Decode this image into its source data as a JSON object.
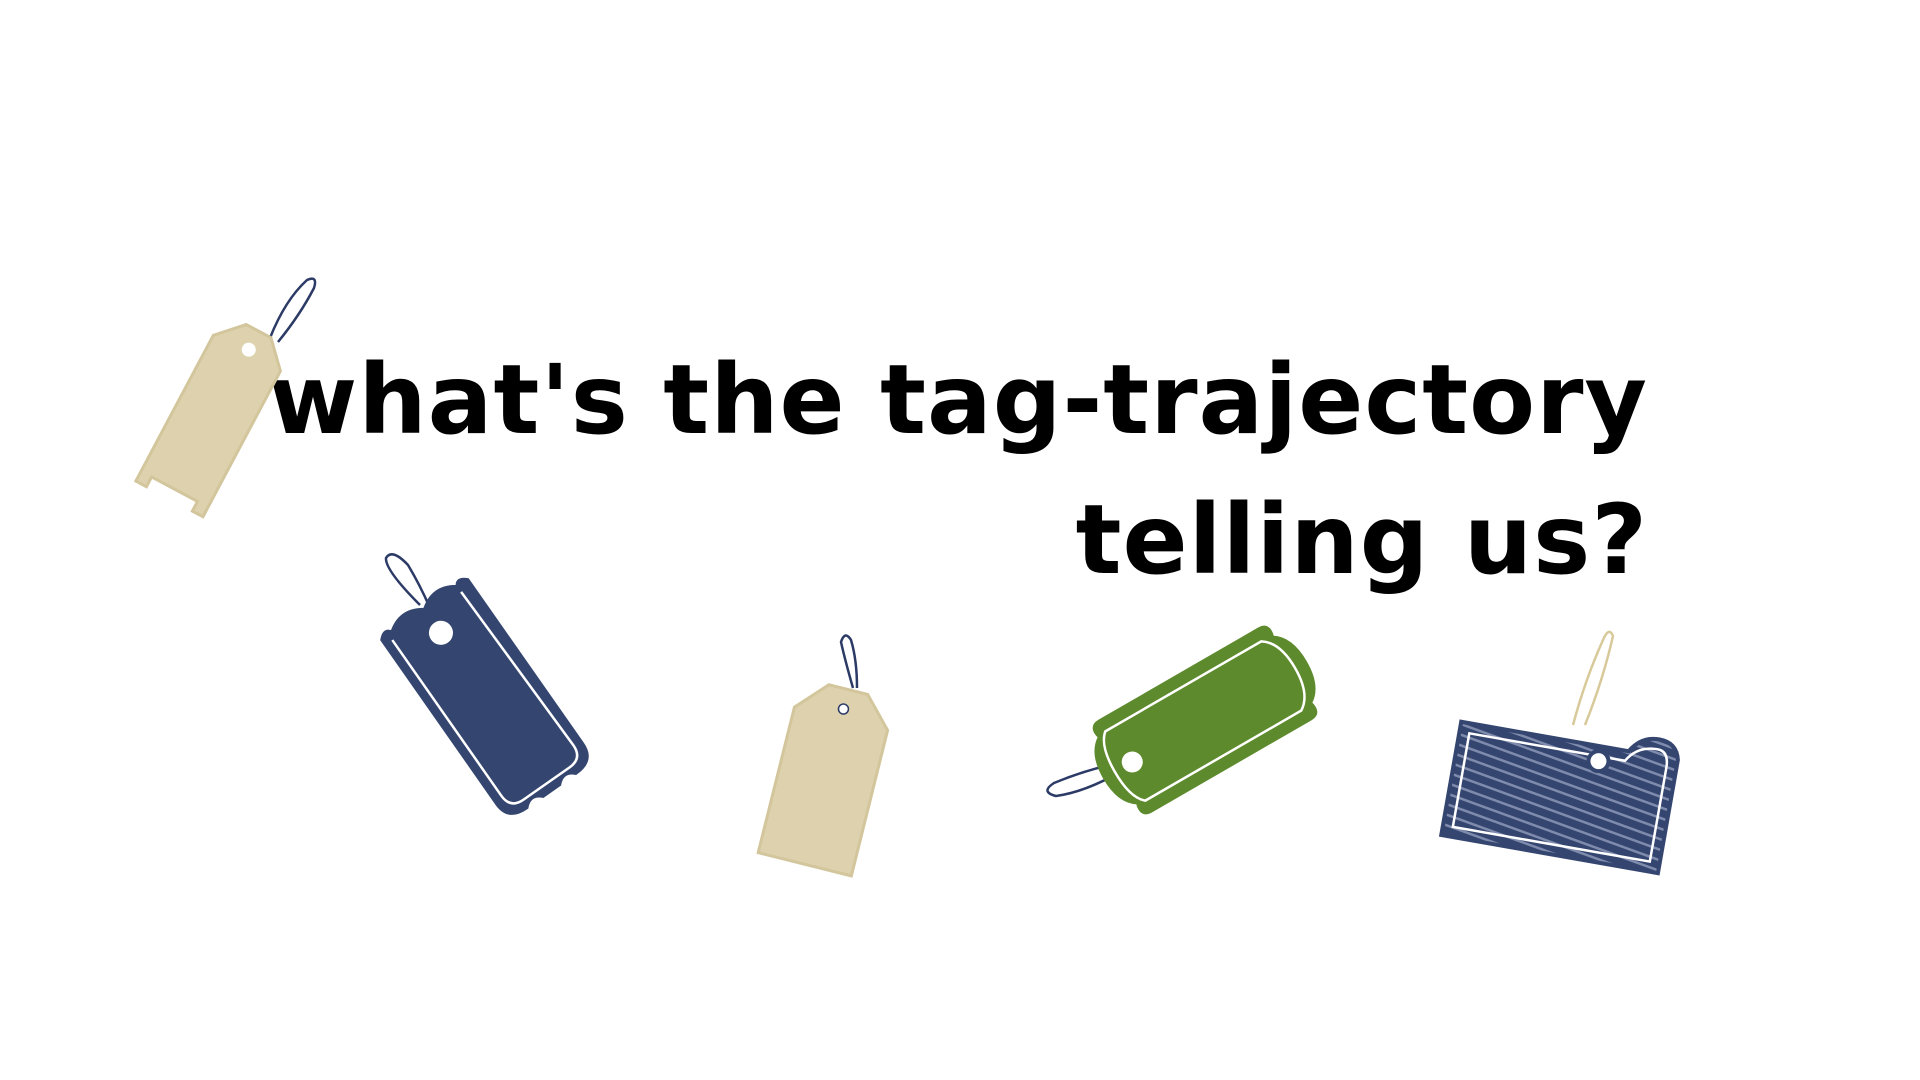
{
  "slide": {
    "headline": {
      "line1": "what's the tag-trajectory",
      "line2": "telling us?"
    }
  },
  "colors": {
    "background": "#ffffff",
    "text": "#000000",
    "tag_beige": "#ddd2ad",
    "tag_navy": "#34456f",
    "tag_green": "#5d8a2c",
    "string_navy": "#2c3a66",
    "string_beige": "#d8c99a"
  },
  "tags": [
    {
      "name": "beige-ticket-tag-icon",
      "color": "tag_beige"
    },
    {
      "name": "navy-scalloped-tag-icon",
      "color": "tag_navy"
    },
    {
      "name": "beige-classic-tag-icon",
      "color": "tag_beige"
    },
    {
      "name": "green-ticket-tag-icon",
      "color": "tag_green"
    },
    {
      "name": "navy-striped-tag-icon",
      "color": "tag_navy"
    }
  ]
}
